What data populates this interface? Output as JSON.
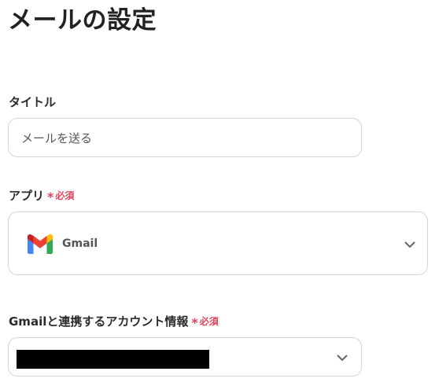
{
  "page": {
    "title": "メールの設定"
  },
  "title_field": {
    "label": "タイトル",
    "value": "メールを送る"
  },
  "app_field": {
    "label": "アプリ",
    "required_mark": "*",
    "required_text": "必須",
    "selected_app": "Gmail",
    "icon": "gmail-logo"
  },
  "account_field": {
    "label": "Gmailと連携するアカウント情報",
    "required_mark": "*",
    "required_text": "必須"
  },
  "colors": {
    "required": "#e0445b",
    "border": "#d5d5d5"
  }
}
